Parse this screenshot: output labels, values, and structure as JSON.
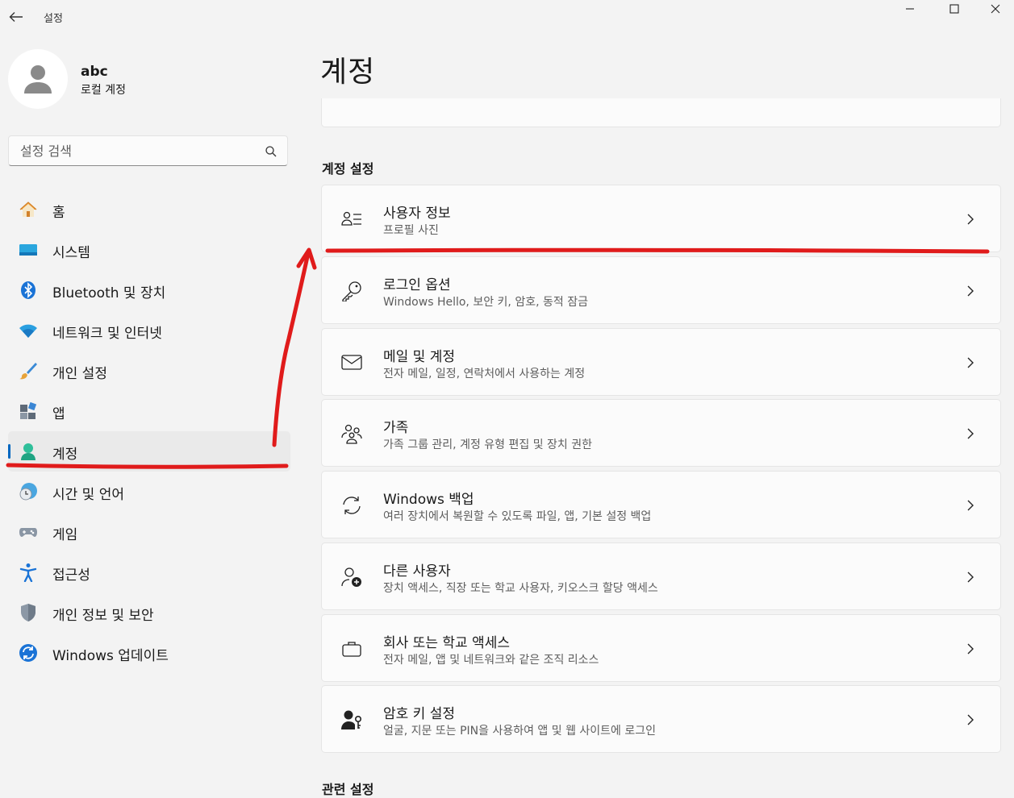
{
  "window": {
    "title": "설정"
  },
  "profile": {
    "name": "abc",
    "account_type": "로컬 계정"
  },
  "search": {
    "placeholder": "설정 검색"
  },
  "sidebar": {
    "items": [
      {
        "label": "홈",
        "icon": "home-icon"
      },
      {
        "label": "시스템",
        "icon": "system-icon"
      },
      {
        "label": "Bluetooth 및 장치",
        "icon": "bluetooth-icon"
      },
      {
        "label": "네트워크 및 인터넷",
        "icon": "wifi-icon"
      },
      {
        "label": "개인 설정",
        "icon": "brush-icon"
      },
      {
        "label": "앱",
        "icon": "apps-icon"
      },
      {
        "label": "계정",
        "icon": "account-icon",
        "selected": true
      },
      {
        "label": "시간 및 언어",
        "icon": "time-language-icon"
      },
      {
        "label": "게임",
        "icon": "gamepad-icon"
      },
      {
        "label": "접근성",
        "icon": "accessibility-icon"
      },
      {
        "label": "개인 정보 및 보안",
        "icon": "shield-icon"
      },
      {
        "label": "Windows 업데이트",
        "icon": "update-icon"
      }
    ]
  },
  "main": {
    "title": "계정",
    "section_title": "계정 설정",
    "next_section_title": "관련 설정",
    "cards": [
      {
        "title": "사용자 정보",
        "subtitle": "프로필 사진",
        "icon": "user-info-icon"
      },
      {
        "title": "로그인 옵션",
        "subtitle": "Windows Hello, 보안 키, 암호, 동적 잠금",
        "icon": "key-icon"
      },
      {
        "title": "메일 및 계정",
        "subtitle": "전자 메일, 일정, 연락처에서 사용하는 계정",
        "icon": "mail-icon"
      },
      {
        "title": "가족",
        "subtitle": "가족 그룹 관리, 계정 유형 편집 및 장치 권한",
        "icon": "family-icon"
      },
      {
        "title": "Windows 백업",
        "subtitle": "여러 장치에서 복원할 수 있도록 파일, 앱, 기본 설정 백업",
        "icon": "sync-icon"
      },
      {
        "title": "다른 사용자",
        "subtitle": "장치 액세스, 직장 또는 학교 사용자, 키오스크 할당 액세스",
        "icon": "add-user-icon"
      },
      {
        "title": "회사 또는 학교 액세스",
        "subtitle": "전자 메일, 앱 및 네트워크와 같은 조직 리소스",
        "icon": "briefcase-icon"
      },
      {
        "title": "암호 키 설정",
        "subtitle": "얼굴, 지문 또는 PIN을 사용하여 앱 및 웹 사이트에 로그인",
        "icon": "passkey-icon"
      }
    ]
  },
  "colors": {
    "accent": "#0067c0",
    "annotation": "#e01b1b",
    "background": "#f3f3f3",
    "card": "#fbfbfb"
  }
}
